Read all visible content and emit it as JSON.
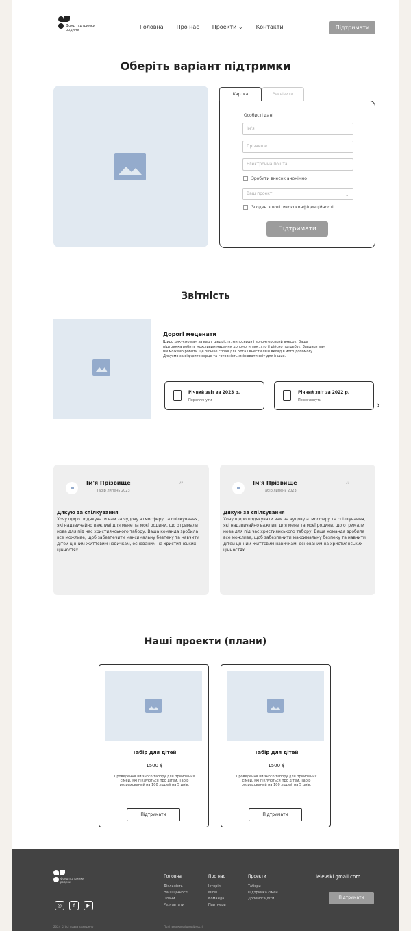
{
  "header": {
    "logo_text": "Фонд підтримки родини",
    "nav": [
      "Головна",
      "Про нас",
      "Проекти",
      "Контакти"
    ],
    "nav_dropdown_icon": "chevron-down-icon",
    "support_button": "Підтримати"
  },
  "support_section": {
    "title": "Оберіть варіант підтримки",
    "tabs": [
      "Картка",
      "Реквізити"
    ],
    "personal_data_label": "Особисті дані",
    "fields": [
      "Ім'я",
      "Прізвище",
      "Електронна пошта"
    ],
    "anonymous_checkbox": "Зробити внесок анонімно",
    "select_placeholder": "Ваш проект",
    "privacy_checkbox": "Згоден з політикою конфіденційності",
    "submit_button": "Підтримати"
  },
  "reports_section": {
    "title": "Звітність",
    "heading": "Дорогі меценати",
    "text": "Щиро дякуємо вам за вашу щедрість, милосердя і волонтерський внесок. Ваша підтримка робить можливим надання допомоги тим, хто її дійсно потребує. Завдяки вам ми можемо робити ще більше справ для Бога і внести свій вклад в його допомогу. Дякуємо за відкрите серце та готовність змінювати світ для інших.",
    "cards": [
      {
        "title": "Річний звіт за 2023 р.",
        "subtitle": "Переглянути"
      },
      {
        "title": "Річний звіт за 2022 р.",
        "subtitle": "Переглянути"
      }
    ],
    "next_icon": "chevron-right-icon"
  },
  "reviews": [
    {
      "name": "Ім'я Прізвище",
      "date": "Табір липень 2023",
      "heading": "Дякую за спілкування",
      "text": "Хочу щиро подякувати вам за чудову атмосферу та спілкування, які надзвичайно важливі для мене та моєї родини, що отримали нова для під час християнського табору. Ваша команда зробила все можливе, щоб забезпечити максимальну безпеку та навчити дітей цінним життєвим навичкам, основаним на християнських цінностях."
    },
    {
      "name": "Ім'я Прізвище",
      "date": "Табір липень 2023",
      "heading": "Дякую за спілкування",
      "text": "Хочу щиро подякувати вам за чудову атмосферу та спілкування, які надзвичайно важливі для мене та моєї родини, що отримали нова для під час християнського табору. Ваша команда зробила все можливе, щоб забезпечити максимальну безпеку та навчити дітей цінним життєвим навичкам, основаним на християнських цінностях."
    }
  ],
  "projects_section": {
    "title": "Наші проекти (плани)",
    "items": [
      {
        "title": "Табір для дітей",
        "price": "1500 $",
        "description": "Проведення виїзного табору для прийомних сімей, які піклуються про дітей. Табір розрахований на 100 людей на 5 днів.",
        "button": "Підтримати"
      },
      {
        "title": "Табір для дітей",
        "price": "1500 $",
        "description": "Проведення виїзного табору для прийомних сімей, які піклуються про дітей. Табір розрахований на 100 людей на 5 днів.",
        "button": "Підтримати"
      }
    ]
  },
  "footer": {
    "logo_text": "Фонд підтримки родини",
    "social_icons": [
      "instagram-icon",
      "facebook-icon",
      "youtube-icon"
    ],
    "columns": [
      {
        "heading": "Головна",
        "items": [
          "Діяльність",
          "Наші цінності",
          "Плани",
          "Результати"
        ]
      },
      {
        "heading": "Про нас",
        "items": [
          "Історія",
          "Місія",
          "Команда",
          "Партнери"
        ]
      },
      {
        "heading": "Проекти",
        "items": [
          "Табори",
          "Підтримка сімей",
          "Допомога діти"
        ]
      }
    ],
    "email": "lelevski.gmail.com",
    "support_button": "Підтримати",
    "copyright": "2024 © Усі права захищено",
    "policy": "Політика конфіденційності"
  }
}
